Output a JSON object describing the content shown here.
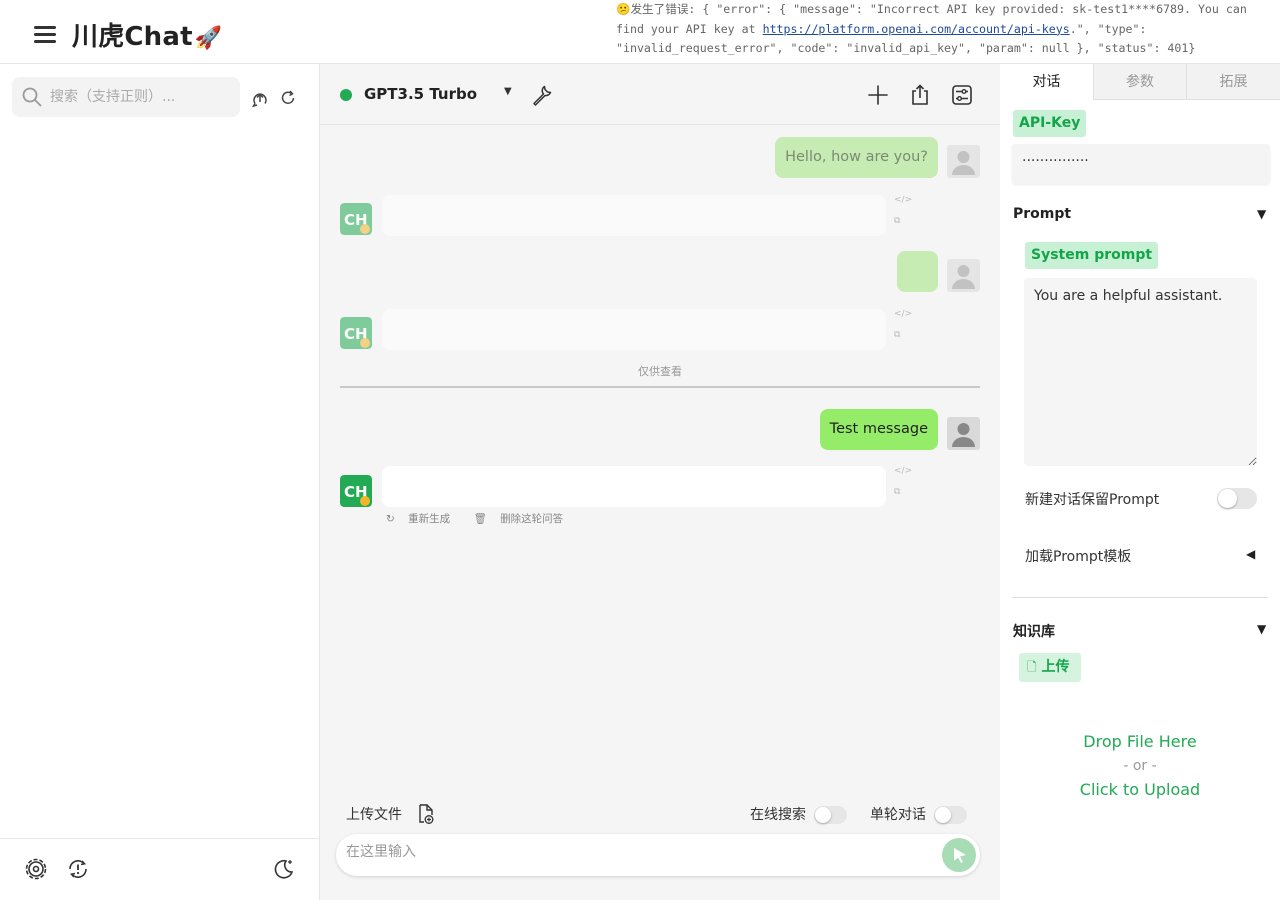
{
  "app": {
    "title": "川虎Chat",
    "title_emoji": "🚀"
  },
  "error": {
    "prefix_emoji": "😕",
    "text_before_link": "发生了错误: { \"error\": { \"message\": \"Incorrect API key provided: sk-test1****6789. You can find your API key at ",
    "link": "https://platform.openai.com/account/api-keys",
    "text_after_link": ".\", \"type\": \"invalid_request_error\", \"code\": \"invalid_api_key\", \"param\": null }, \"status\": 401}"
  },
  "sidebar": {
    "search_placeholder": "搜索（支持正则）..."
  },
  "chat": {
    "model": "GPT3.5 Turbo",
    "status_color": "#22aa55",
    "messages": [
      {
        "role": "user",
        "text": "Hello, how are you?",
        "faded": true
      },
      {
        "role": "assistant",
        "text": "",
        "faded": true
      },
      {
        "role": "user",
        "text": "",
        "faded": true
      },
      {
        "role": "assistant",
        "text": "",
        "faded": true
      },
      {
        "role": "user",
        "text": "Test message",
        "faded": false
      },
      {
        "role": "assistant",
        "text": "",
        "faded": false
      }
    ],
    "divider_label": "仅供查看",
    "actions": {
      "regenerate": "重新生成",
      "delete_round": "删除这轮问答"
    },
    "upload_file_label": "上传文件",
    "online_search_label": "在线搜索",
    "single_turn_label": "单轮对话",
    "input_placeholder": "在这里输入"
  },
  "right_panel": {
    "tabs": [
      "对话",
      "参数",
      "拓展"
    ],
    "api_key_label": "API-Key",
    "api_key_value": "···············",
    "prompt_section": "Prompt",
    "system_prompt_label": "System prompt",
    "system_prompt_value": "You are a helpful assistant.",
    "keep_prompt_label": "新建对话保留Prompt",
    "load_template_label": "加载Prompt模板",
    "knowledge_section": "知识库",
    "upload_button": "上传",
    "drop_file": "Drop File Here",
    "or": "- or -",
    "click_upload": "Click to Upload"
  },
  "colors": {
    "accent": "#22aa55",
    "user_bubble": "#95ec69",
    "chip_bg": "#c8f0d4"
  }
}
